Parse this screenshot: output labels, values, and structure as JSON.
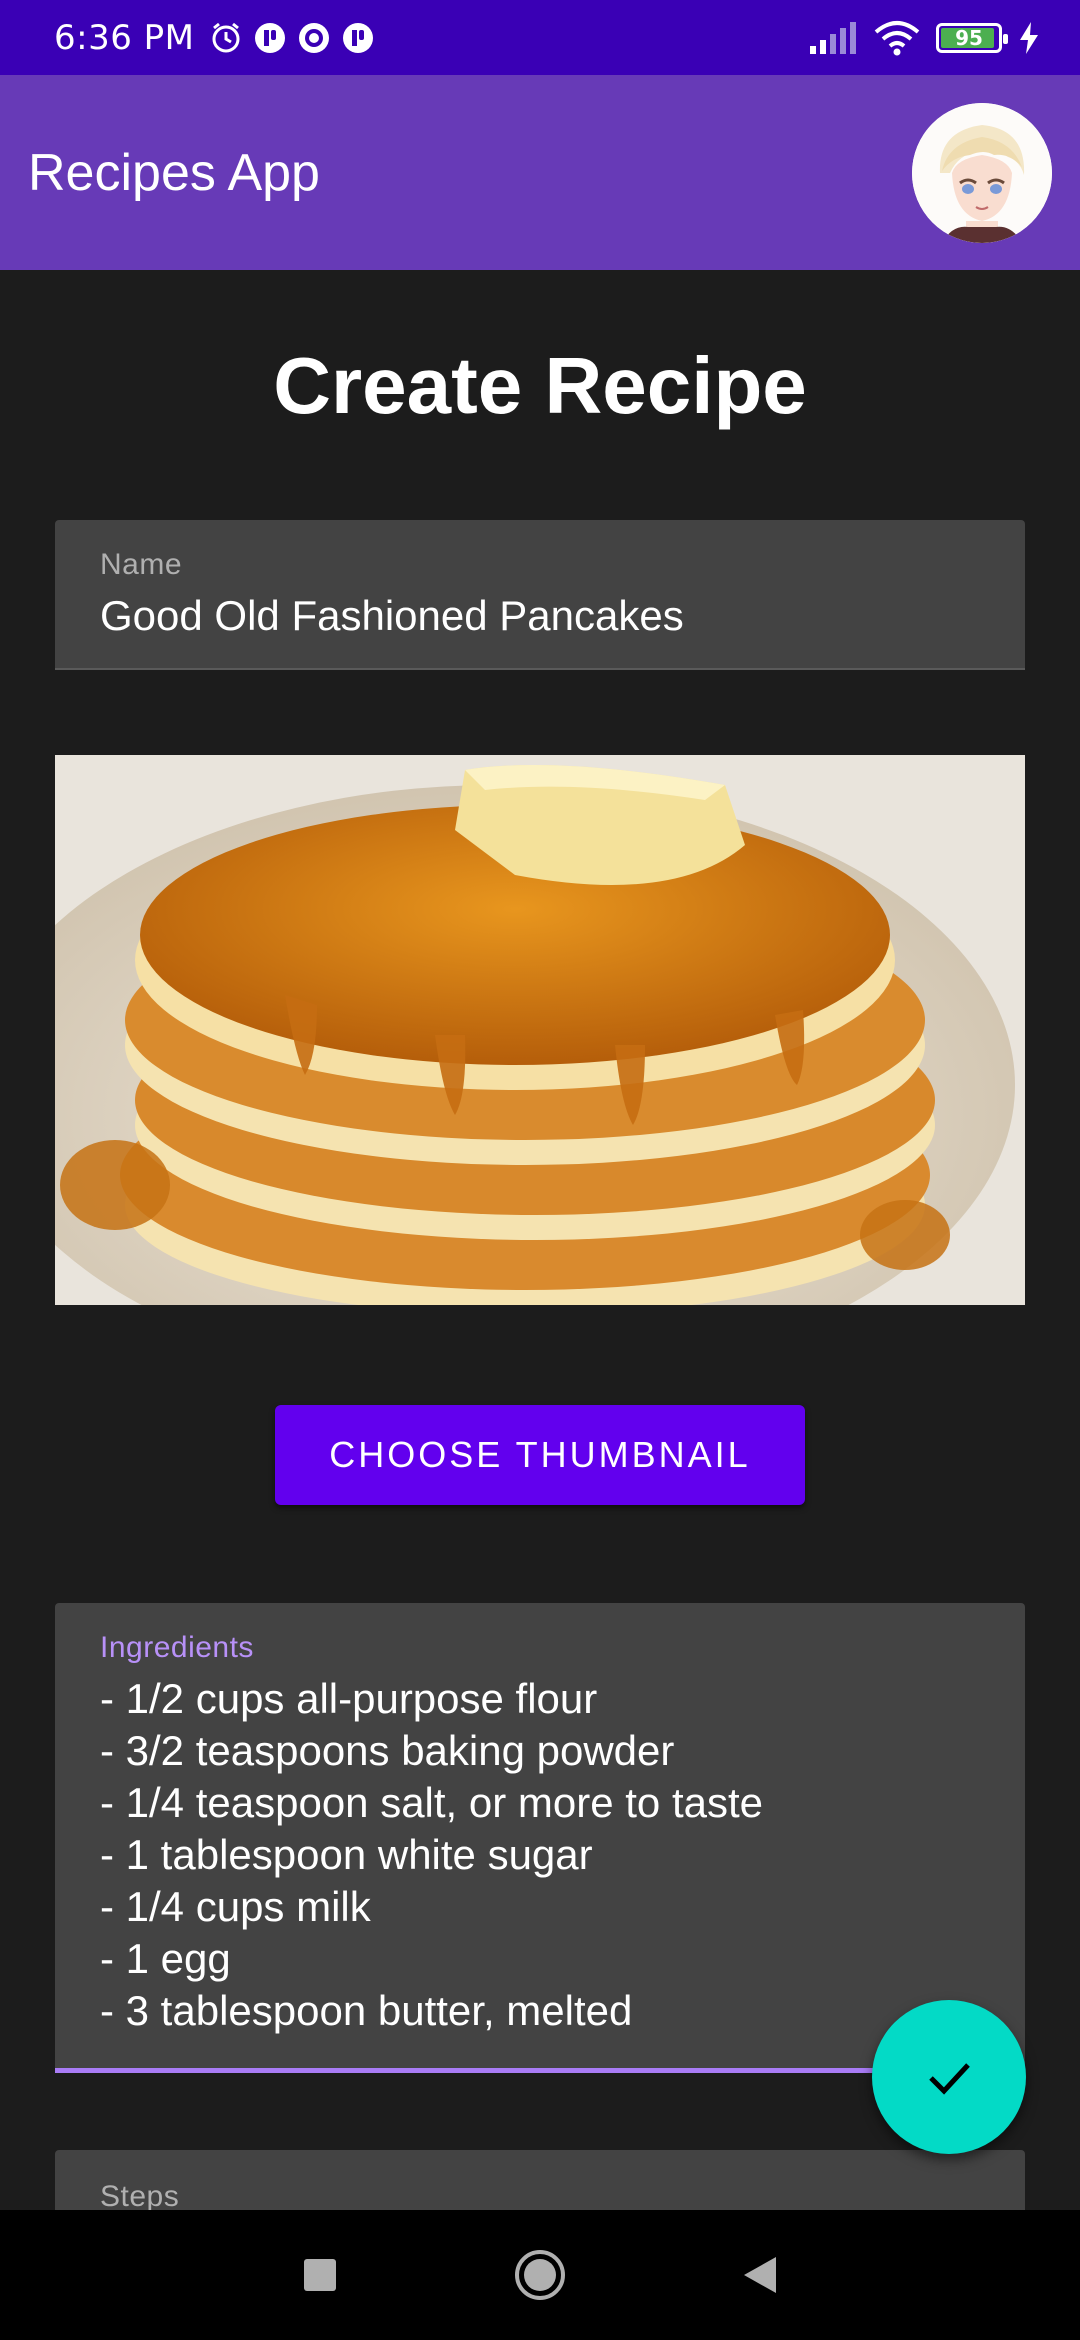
{
  "status_bar": {
    "time": "6:36 PM",
    "battery_level": "95",
    "battery_fraction": 0.95,
    "icons": [
      "alarm-icon",
      "app-notification-icon",
      "record-icon",
      "app-notification-icon",
      "signal-icon",
      "wifi-icon",
      "battery-icon",
      "charging-icon"
    ]
  },
  "app_bar": {
    "title": "Recipes App",
    "avatar_icon": "user-avatar-icon"
  },
  "page": {
    "title": "Create Recipe"
  },
  "form": {
    "name": {
      "label": "Name",
      "value": "Good Old Fashioned Pancakes"
    },
    "thumbnail": {
      "icon": "pancakes-image"
    },
    "choose_thumbnail_label": "CHOOSE THUMBNAIL",
    "ingredients": {
      "label": "Ingredients",
      "lines": [
        "- 1/2 cups all-purpose flour",
        "- 3/2 teaspoons baking powder",
        "- 1/4 teaspoon salt, or more to taste",
        "- 1 tablespoon white sugar",
        "- 1/4 cups milk",
        "- 1 egg",
        "- 3 tablespoon butter, melted"
      ]
    },
    "steps": {
      "label": "Steps"
    }
  },
  "fab": {
    "icon": "check-icon"
  },
  "nav_bar": {
    "icons": [
      "recents-icon",
      "home-icon",
      "back-icon"
    ]
  },
  "colors": {
    "status_bar": "#3a00b5",
    "app_bar": "#673ab7",
    "background": "#1c1c1c",
    "field": "#434343",
    "accent_purple": "#6200ee",
    "focus_underline": "#a97cf6",
    "fab": "#03dac6"
  }
}
